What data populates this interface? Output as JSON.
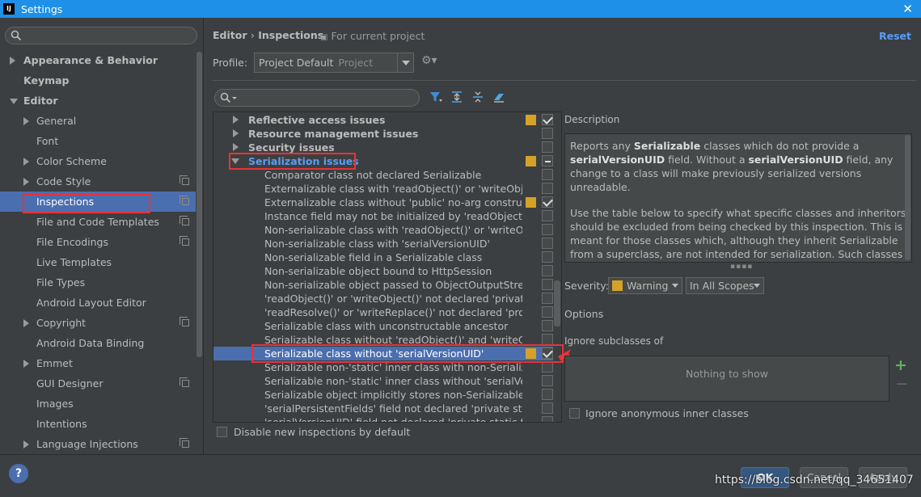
{
  "window": {
    "title": "Settings",
    "app_icon_text": "IJ"
  },
  "sidebar": {
    "items": [
      {
        "label": "Appearance & Behavior",
        "arrow": "right",
        "bold": true,
        "indent": 0
      },
      {
        "label": "Keymap",
        "arrow": "",
        "bold": true,
        "indent": 0
      },
      {
        "label": "Editor",
        "arrow": "down",
        "bold": true,
        "indent": 0
      },
      {
        "label": "General",
        "arrow": "right",
        "bold": false,
        "indent": 1
      },
      {
        "label": "Font",
        "arrow": "",
        "bold": false,
        "indent": 1
      },
      {
        "label": "Color Scheme",
        "arrow": "right",
        "bold": false,
        "indent": 1
      },
      {
        "label": "Code Style",
        "arrow": "right",
        "bold": false,
        "indent": 1,
        "icon": true
      },
      {
        "label": "Inspections",
        "arrow": "",
        "bold": false,
        "indent": 1,
        "icon": true,
        "selected": true
      },
      {
        "label": "File and Code Templates",
        "arrow": "",
        "bold": false,
        "indent": 1,
        "icon": true
      },
      {
        "label": "File Encodings",
        "arrow": "",
        "bold": false,
        "indent": 1,
        "icon": true
      },
      {
        "label": "Live Templates",
        "arrow": "",
        "bold": false,
        "indent": 1
      },
      {
        "label": "File Types",
        "arrow": "",
        "bold": false,
        "indent": 1
      },
      {
        "label": "Android Layout Editor",
        "arrow": "",
        "bold": false,
        "indent": 1
      },
      {
        "label": "Copyright",
        "arrow": "right",
        "bold": false,
        "indent": 1,
        "icon": true
      },
      {
        "label": "Android Data Binding",
        "arrow": "",
        "bold": false,
        "indent": 1
      },
      {
        "label": "Emmet",
        "arrow": "right",
        "bold": false,
        "indent": 1
      },
      {
        "label": "GUI Designer",
        "arrow": "",
        "bold": false,
        "indent": 1,
        "icon": true
      },
      {
        "label": "Images",
        "arrow": "",
        "bold": false,
        "indent": 1
      },
      {
        "label": "Intentions",
        "arrow": "",
        "bold": false,
        "indent": 1
      },
      {
        "label": "Language Injections",
        "arrow": "right",
        "bold": false,
        "indent": 1,
        "icon": true
      }
    ]
  },
  "header": {
    "breadcrumb_editor": "Editor",
    "breadcrumb_sep": "›",
    "breadcrumb_page": "Inspections",
    "scope_note": "For current project",
    "reset_label": "Reset",
    "profile_label": "Profile:",
    "profile_value": "Project Default",
    "profile_sub": "Project"
  },
  "inspections": [
    {
      "label": "Reflective access issues",
      "group": true,
      "arrow": "right",
      "sev": true,
      "check": "checked"
    },
    {
      "label": "Resource management issues",
      "group": true,
      "arrow": "right",
      "sev": false,
      "check": "none"
    },
    {
      "label": "Security issues",
      "group": true,
      "arrow": "right",
      "sev": false,
      "check": "none"
    },
    {
      "label": "Serialization issues",
      "group": true,
      "arrow": "down",
      "sev": true,
      "check": "mixed",
      "blue": true
    },
    {
      "label": "Comparator class not declared Serializable",
      "group": false,
      "sev": false,
      "check": "none"
    },
    {
      "label": "Externalizable class with 'readObject()' or 'writeObject()'",
      "group": false,
      "sev": false,
      "check": "none"
    },
    {
      "label": "Externalizable class without 'public' no-arg constructor",
      "group": false,
      "sev": true,
      "check": "checked"
    },
    {
      "label": "Instance field may not be initialized by 'readObject()'",
      "group": false,
      "sev": false,
      "check": "none"
    },
    {
      "label": "Non-serializable class with 'readObject()' or 'writeObject()'",
      "group": false,
      "sev": false,
      "check": "none"
    },
    {
      "label": "Non-serializable class with 'serialVersionUID'",
      "group": false,
      "sev": false,
      "check": "none"
    },
    {
      "label": "Non-serializable field in a Serializable class",
      "group": false,
      "sev": false,
      "check": "none"
    },
    {
      "label": "Non-serializable object bound to HttpSession",
      "group": false,
      "sev": false,
      "check": "none"
    },
    {
      "label": "Non-serializable object passed to ObjectOutputStream",
      "group": false,
      "sev": false,
      "check": "none"
    },
    {
      "label": "'readObject()' or 'writeObject()' not declared 'private'",
      "group": false,
      "sev": false,
      "check": "none"
    },
    {
      "label": "'readResolve()' or 'writeReplace()' not declared 'protected'",
      "group": false,
      "sev": false,
      "check": "none"
    },
    {
      "label": "Serializable class with unconstructable ancestor",
      "group": false,
      "sev": false,
      "check": "none"
    },
    {
      "label": "Serializable class without 'readObject()' and 'writeObject()'",
      "group": false,
      "sev": false,
      "check": "none"
    },
    {
      "label": "Serializable class without 'serialVersionUID'",
      "group": false,
      "sev": true,
      "check": "checked",
      "selected": true
    },
    {
      "label": "Serializable non-'static' inner class with non-Serializable outer class",
      "group": false,
      "sev": false,
      "check": "none"
    },
    {
      "label": "Serializable non-'static' inner class without 'serialVersionUID'",
      "group": false,
      "sev": false,
      "check": "none"
    },
    {
      "label": "Serializable object implicitly stores non-Serializable object",
      "group": false,
      "sev": false,
      "check": "none"
    },
    {
      "label": "'serialPersistentFields' field not declared 'private static final'",
      "group": false,
      "sev": false,
      "check": "none"
    },
    {
      "label": "'serialVersionUID' field not declared 'private static final long'",
      "group": false,
      "sev": false,
      "check": "none"
    }
  ],
  "bottom": {
    "disable_new_label": "Disable new inspections by default"
  },
  "description": {
    "label": "Description",
    "p1_a": "Reports any ",
    "p1_b": "Serializable",
    "p1_c": " classes which do not provide a ",
    "p1_d": "serialVersionUID",
    "p1_e": " field. Without a ",
    "p1_f": "serialVersionUID",
    "p1_g": " field, any change to a class will make previously serialized versions unreadable.",
    "p2": "Use the table below to specify what specific classes and inheritors should be excluded from being checked by this inspection. This is meant for those classes which, although they inherit Serializable from a superclass, are not intended for serialization. Such classes would inhibit the serialization process."
  },
  "severity": {
    "label": "Severity:",
    "value": "Warning",
    "scope": "In All Scopes",
    "color": "#d5a227"
  },
  "options": {
    "label": "Options",
    "ignore_label": "Ignore subclasses of",
    "empty_text": "Nothing to show",
    "add": "+",
    "remove": "−",
    "anon_label": "Ignore anonymous inner classes"
  },
  "footer": {
    "help": "?",
    "ok": "OK",
    "cancel": "Cancel",
    "apply": "Apply",
    "watermark": "https://blog.csdn.net/qq_34651407"
  },
  "colors": {
    "accent": "#4b6eaf",
    "title_bar": "#1e90e8",
    "highlight": "#e8323a",
    "link": "#589df6"
  }
}
